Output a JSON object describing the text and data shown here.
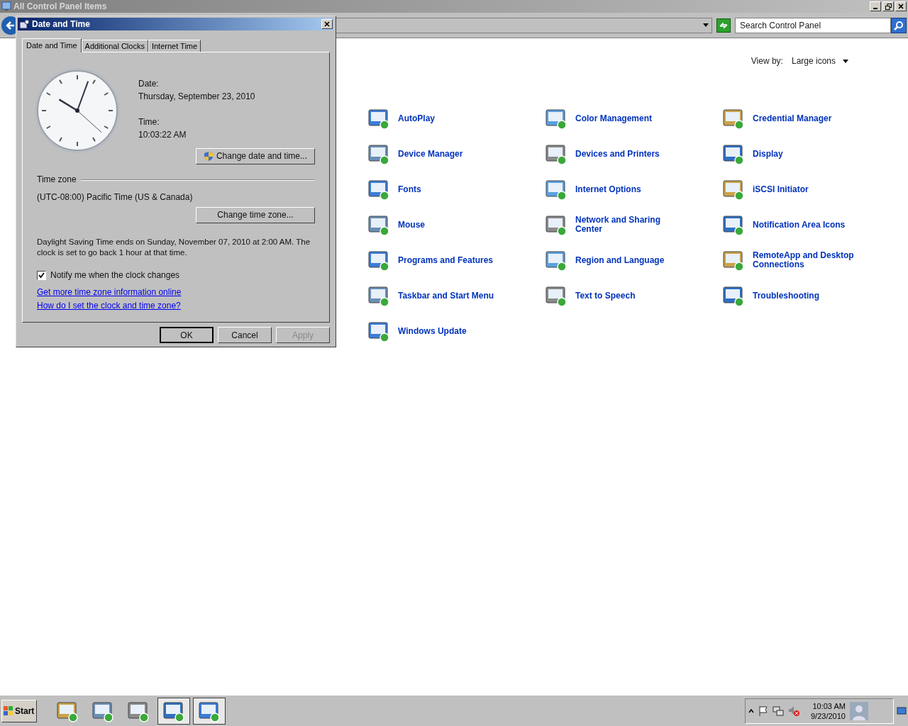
{
  "window": {
    "title": "All Control Panel Items"
  },
  "search": {
    "placeholder": "Search Control Panel"
  },
  "view_by": {
    "label": "View by:",
    "value": "Large icons"
  },
  "items": [
    {
      "label": "AutoPlay"
    },
    {
      "label": "Color Management"
    },
    {
      "label": "Credential Manager"
    },
    {
      "label": "Device Manager"
    },
    {
      "label": "Devices and Printers"
    },
    {
      "label": "Display"
    },
    {
      "label": "Fonts"
    },
    {
      "label": "Internet Options"
    },
    {
      "label": "iSCSI Initiator"
    },
    {
      "label": "Mouse"
    },
    {
      "label": "Network and Sharing Center"
    },
    {
      "label": "Notification Area Icons"
    },
    {
      "label": "Programs and Features"
    },
    {
      "label": "Region and Language"
    },
    {
      "label": "RemoteApp and Desktop Connections"
    },
    {
      "label": "Taskbar and Start Menu"
    },
    {
      "label": "Text to Speech"
    },
    {
      "label": "Troubleshooting"
    },
    {
      "label": "Windows Update"
    }
  ],
  "dialog": {
    "title": "Date and Time",
    "tabs": [
      {
        "label": "Date and Time",
        "selected": true
      },
      {
        "label": "Additional Clocks",
        "selected": false
      },
      {
        "label": "Internet Time",
        "selected": false
      }
    ],
    "date_label": "Date:",
    "date": "Thursday, September 23, 2010",
    "time_label": "Time:",
    "time": "10:03:22 AM",
    "change_date_button": "Change date and time...",
    "time_zone_heading": "Time zone",
    "time_zone": "(UTC-08:00) Pacific Time (US & Canada)",
    "change_zone_button": "Change time zone...",
    "dst_note": "Daylight Saving Time ends on Sunday, November 07, 2010 at 2:00 AM. The clock is set to go back 1 hour at that time.",
    "notify": {
      "label": "Notify me when the clock changes",
      "checked": true
    },
    "links": [
      "Get more time zone information online",
      "How do I set the clock and time zone?"
    ],
    "buttons": [
      {
        "label": "OK",
        "disabled": false
      },
      {
        "label": "Cancel",
        "disabled": false
      },
      {
        "label": "Apply",
        "disabled": true
      }
    ]
  },
  "taskbar": {
    "start": "Start",
    "apps": [
      {
        "selected": false
      },
      {
        "selected": false
      },
      {
        "selected": false
      },
      {
        "selected": true
      },
      {
        "selected": true
      }
    ],
    "clock_time": "10:03 AM",
    "clock_date": "9/23/2010"
  }
}
